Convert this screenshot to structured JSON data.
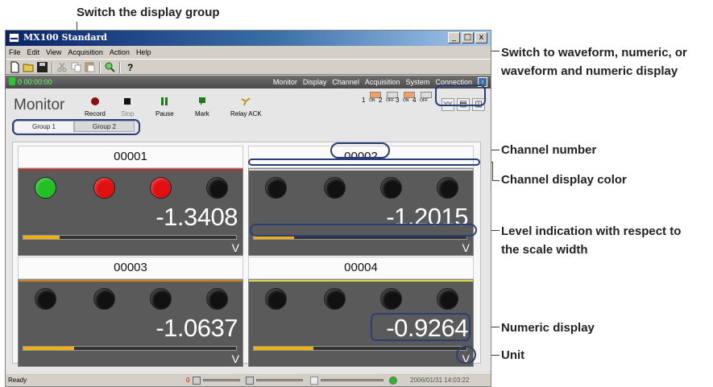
{
  "annotations": {
    "switch_group": "Switch the display group",
    "switch_display_1": "Switch to waveform, numeric, or",
    "switch_display_2": "waveform and numeric display",
    "channel_number": "Channel number",
    "channel_color": "Channel display color",
    "level_1": "Level indication with respect to",
    "level_2": "the scale width",
    "numeric_display": "Numeric display",
    "unit": "Unit"
  },
  "window": {
    "title": "MX100 Standard",
    "minimize": "_",
    "maximize": "□",
    "close": "x"
  },
  "menu": [
    "File",
    "Edit",
    "View",
    "Acquisition",
    "Action",
    "Help"
  ],
  "toolbar_icons": [
    "new-file-icon",
    "open-folder-icon",
    "save-icon",
    "cut-icon",
    "copy-icon",
    "paste-icon",
    "search-icon",
    "help-icon"
  ],
  "strip": {
    "time": "0 00:00:00",
    "nav": [
      "Monitor",
      "Display",
      "Channel",
      "Acquisition",
      "System",
      "Connection"
    ],
    "up": "↑"
  },
  "monitor": {
    "title": "Monitor",
    "tools": [
      {
        "label": "Record",
        "icon": "record-icon"
      },
      {
        "label": "Stop",
        "icon": "stop-icon"
      },
      {
        "label": "Pause",
        "icon": "pause-icon"
      },
      {
        "label": "Mark",
        "icon": "mark-icon"
      },
      {
        "label": "Relay ACK",
        "icon": "relay-ack-icon"
      }
    ],
    "tabs": [
      "Group 1",
      "Group 2"
    ],
    "channel_states": [
      {
        "n": "1",
        "state": "ON"
      },
      {
        "n": "2",
        "state": "OFF"
      },
      {
        "n": "3",
        "state": "ON"
      },
      {
        "n": "4",
        "state": "OFF"
      }
    ],
    "display_buttons": [
      "waveform-display-icon",
      "numeric-display-icon",
      "waveform-numeric-display-icon"
    ]
  },
  "channels": [
    {
      "number": "00001",
      "value": "-1.3408",
      "unit": "V",
      "color": "#c0302a",
      "level": 0.17,
      "lamps": [
        "#22c022",
        "#e01010",
        "#e01010",
        "#111111"
      ]
    },
    {
      "number": "00002",
      "value": "-1.2015",
      "unit": "V",
      "color": "#d8d8d8",
      "level": 0.19,
      "lamps": [
        "#111111",
        "#111111",
        "#111111",
        "#111111"
      ]
    },
    {
      "number": "00003",
      "value": "-1.0637",
      "unit": "V",
      "color": "#d0801a",
      "level": 0.24,
      "lamps": [
        "#111111",
        "#111111",
        "#111111",
        "#111111"
      ]
    },
    {
      "number": "00004",
      "value": "-0.9264",
      "unit": "V",
      "color": "#e0d84a",
      "level": 0.28,
      "lamps": [
        "#111111",
        "#111111",
        "#111111",
        "#111111"
      ]
    }
  ],
  "status": {
    "ready": "Ready",
    "count": "0",
    "datetime": "2006/01/31 14:03:22"
  }
}
